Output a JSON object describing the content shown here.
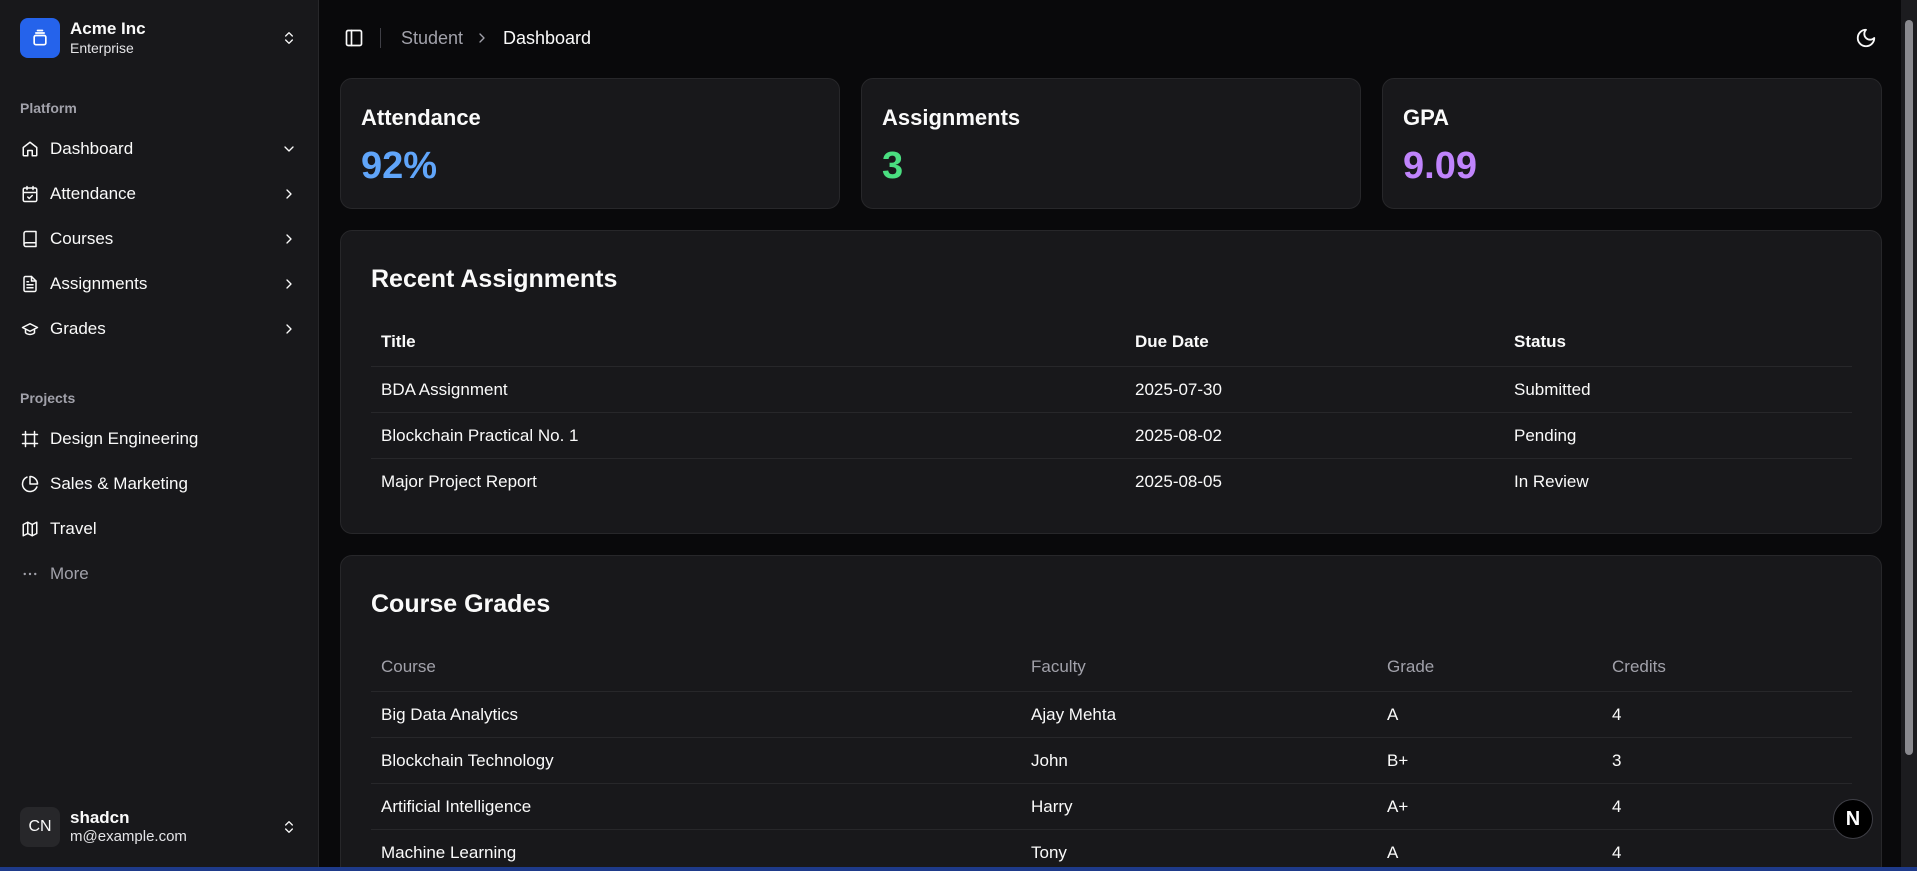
{
  "colors": {
    "accent_blue": "#60a5fa",
    "accent_green": "#4ade80",
    "accent_purple": "#c084fc",
    "team_logo": "#2563eb"
  },
  "team": {
    "name": "Acme Inc",
    "plan": "Enterprise"
  },
  "sidebar": {
    "platform_label": "Platform",
    "platform_items": [
      {
        "label": "Dashboard",
        "icon": "home-icon",
        "chevron": "chevron-down-icon"
      },
      {
        "label": "Attendance",
        "icon": "calendar-check-icon",
        "chevron": "chevron-right-icon"
      },
      {
        "label": "Courses",
        "icon": "book-icon",
        "chevron": "chevron-right-icon"
      },
      {
        "label": "Assignments",
        "icon": "file-text-icon",
        "chevron": "chevron-right-icon"
      },
      {
        "label": "Grades",
        "icon": "graduation-cap-icon",
        "chevron": "chevron-right-icon"
      }
    ],
    "projects_label": "Projects",
    "project_items": [
      {
        "label": "Design Engineering",
        "icon": "frame-icon"
      },
      {
        "label": "Sales & Marketing",
        "icon": "pie-chart-icon"
      },
      {
        "label": "Travel",
        "icon": "map-icon"
      },
      {
        "label": "More",
        "icon": "more-horizontal-icon"
      }
    ]
  },
  "user": {
    "initials": "CN",
    "name": "shadcn",
    "email": "m@example.com"
  },
  "breadcrumb": {
    "parent": "Student",
    "current": "Dashboard"
  },
  "stats": [
    {
      "title": "Attendance",
      "value": "92%"
    },
    {
      "title": "Assignments",
      "value": "3"
    },
    {
      "title": "GPA",
      "value": "9.09"
    }
  ],
  "recent_assignments": {
    "title": "Recent Assignments",
    "columns": [
      "Title",
      "Due Date",
      "Status"
    ],
    "rows": [
      [
        "BDA Assignment",
        "2025-07-30",
        "Submitted"
      ],
      [
        "Blockchain Practical No. 1",
        "2025-08-02",
        "Pending"
      ],
      [
        "Major Project Report",
        "2025-08-05",
        "In Review"
      ]
    ]
  },
  "course_grades": {
    "title": "Course Grades",
    "columns": [
      "Course",
      "Faculty",
      "Grade",
      "Credits"
    ],
    "rows": [
      [
        "Big Data Analytics",
        "Ajay Mehta",
        "A",
        "4"
      ],
      [
        "Blockchain Technology",
        "John",
        "B+",
        "3"
      ],
      [
        "Artificial Intelligence",
        "Harry",
        "A+",
        "4"
      ],
      [
        "Machine Learning",
        "Tony",
        "A",
        "4"
      ]
    ]
  },
  "badge": {
    "letter": "N"
  }
}
